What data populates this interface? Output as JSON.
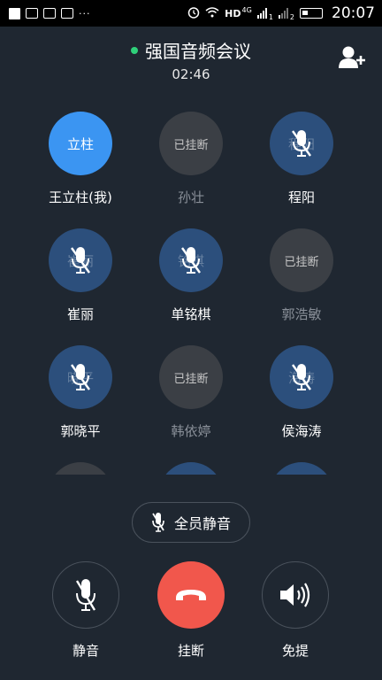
{
  "status_bar": {
    "dots": "···",
    "network": "HD",
    "net_type": "4G",
    "sim1": "1",
    "sim2": "2",
    "time": "20:07"
  },
  "header": {
    "title": "强国音频会议",
    "timer": "02:46"
  },
  "members": [
    {
      "name": "王立柱(我)",
      "avatar_text": "立柱",
      "state": "active"
    },
    {
      "name": "孙壮",
      "avatar_text": "已挂断",
      "state": "hungup"
    },
    {
      "name": "程阳",
      "avatar_text": "程阳",
      "state": "muted"
    },
    {
      "name": "崔丽",
      "avatar_text": "崔丽",
      "state": "muted"
    },
    {
      "name": "单铭棋",
      "avatar_text": "铭棋",
      "state": "muted"
    },
    {
      "name": "郭浩敏",
      "avatar_text": "已挂断",
      "state": "hungup"
    },
    {
      "name": "郭晓平",
      "avatar_text": "晓平",
      "state": "muted"
    },
    {
      "name": "韩依婷",
      "avatar_text": "已挂断",
      "state": "hungup"
    },
    {
      "name": "侯海涛",
      "avatar_text": "海涛",
      "state": "muted"
    }
  ],
  "mute_all_label": "全员静音",
  "controls": {
    "mute_label": "静音",
    "hangup_label": "挂断",
    "speaker_label": "免提"
  },
  "colors": {
    "background": "#1f2731",
    "active_avatar": "#3b95f2",
    "muted_avatar": "#2c4f7c",
    "hungup_avatar": "#3b3f45",
    "hangup_button": "#f1574c",
    "live_dot": "#2fd07a"
  }
}
